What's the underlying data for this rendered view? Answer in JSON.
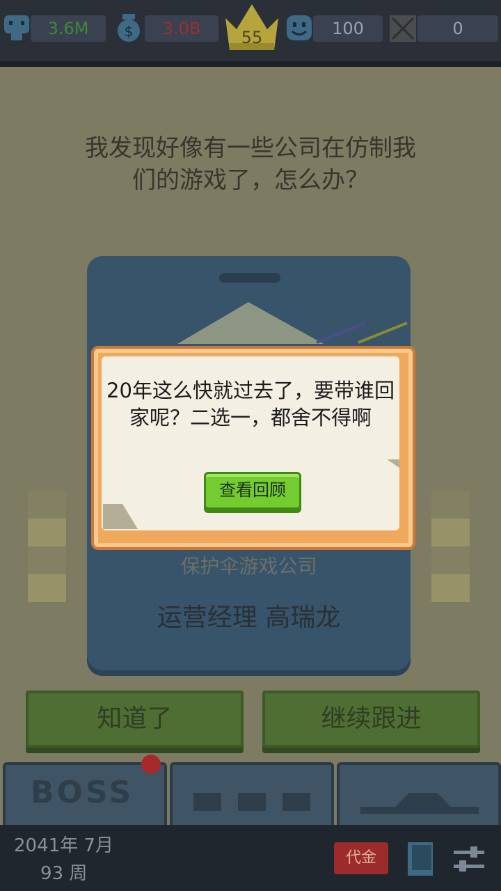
{
  "stats": {
    "employees": "3.6M",
    "money": "3.0B",
    "level": "55",
    "happiness": "100",
    "bugs": "0"
  },
  "event": {
    "question": "我发现好像有一些公司在仿制我们的游戏了，怎么办？",
    "company": "保护伞游戏公司",
    "person": "运营经理 高瑞龙",
    "btn_ok": "知道了",
    "btn_follow": "继续跟进"
  },
  "dialog": {
    "message": "20年这么快就过去了，要带谁回家呢？二选一，都舍不得啊",
    "review_button": "查看回顾"
  },
  "tabs": {
    "boss_label": "BOSS"
  },
  "footer": {
    "date": "2041年 7月",
    "week": "93 周",
    "coin_button": "代金"
  },
  "icons": [
    "employee-icon",
    "money-bag-icon",
    "crown-icon",
    "smile-icon",
    "bug-icon",
    "book-icon",
    "settings-sliders-icon"
  ],
  "colors": {
    "employees_text": "#3c8a3a",
    "money_text": "#9c3030",
    "level_crown": "#b6a43c"
  }
}
